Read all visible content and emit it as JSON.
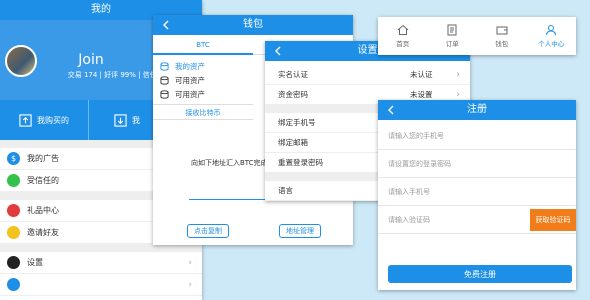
{
  "mine": {
    "title": "我的",
    "username": "Join",
    "stats": "交易 174 | 好评 99% | 信任91%",
    "actions": [
      {
        "label": "我购买的",
        "icon": "upload-icon"
      },
      {
        "label": "我",
        "icon": "download-icon"
      }
    ],
    "menu": [
      {
        "label": "我的广告",
        "icon": "dollar-icon",
        "color": "#1e8fe6"
      },
      {
        "label": "受信任的",
        "icon": "shield-icon",
        "color": "#34c24a"
      },
      {
        "label": "礼品中心",
        "icon": "gift-icon",
        "color": "#e33b3b"
      },
      {
        "label": "邀请好友",
        "icon": "invite-icon",
        "color": "#f2c21d"
      },
      {
        "label": "设置",
        "icon": "gear-icon",
        "color": "#222222"
      },
      {
        "label": "",
        "icon": "help-icon",
        "color": "#1e8fe6"
      }
    ]
  },
  "wallet": {
    "title": "钱包",
    "tabs": [
      "BTC",
      ""
    ],
    "assets": [
      "我的资产",
      "可用资产",
      "可用资产"
    ],
    "receive_tab": "接收比特币",
    "receive_text": "向如下地址汇入BTC完成",
    "copy_button": "点击复制",
    "address_button": "地址管理"
  },
  "settings": {
    "title": "设置",
    "rows": [
      {
        "label": "实名认证",
        "value": "未认证"
      },
      {
        "label": "资金密码",
        "value": "未设置"
      },
      {
        "label": "绑定手机号",
        "value": ""
      },
      {
        "label": "绑定邮箱",
        "value": ""
      },
      {
        "label": "重置登录密码",
        "value": ""
      },
      {
        "label": "语言",
        "value": ""
      }
    ]
  },
  "tabbar": {
    "items": [
      {
        "label": "首页",
        "icon": "home-icon",
        "active": false
      },
      {
        "label": "订单",
        "icon": "order-icon",
        "active": false
      },
      {
        "label": "钱包",
        "icon": "wallet-icon",
        "active": false
      },
      {
        "label": "个人中心",
        "icon": "user-icon",
        "active": true
      }
    ]
  },
  "register": {
    "title": "注册",
    "fields": [
      {
        "placeholder": "请输入您的手机号"
      },
      {
        "placeholder": "请设置您的登录密码"
      },
      {
        "placeholder": "请输入手机号"
      },
      {
        "placeholder": "请输入验证码"
      }
    ],
    "code_button": "获取验证码",
    "submit_button": "免费注册"
  },
  "colors": {
    "accent": "#1e8fe6",
    "orange": "#f07c1a",
    "background": "#cde9f7"
  }
}
